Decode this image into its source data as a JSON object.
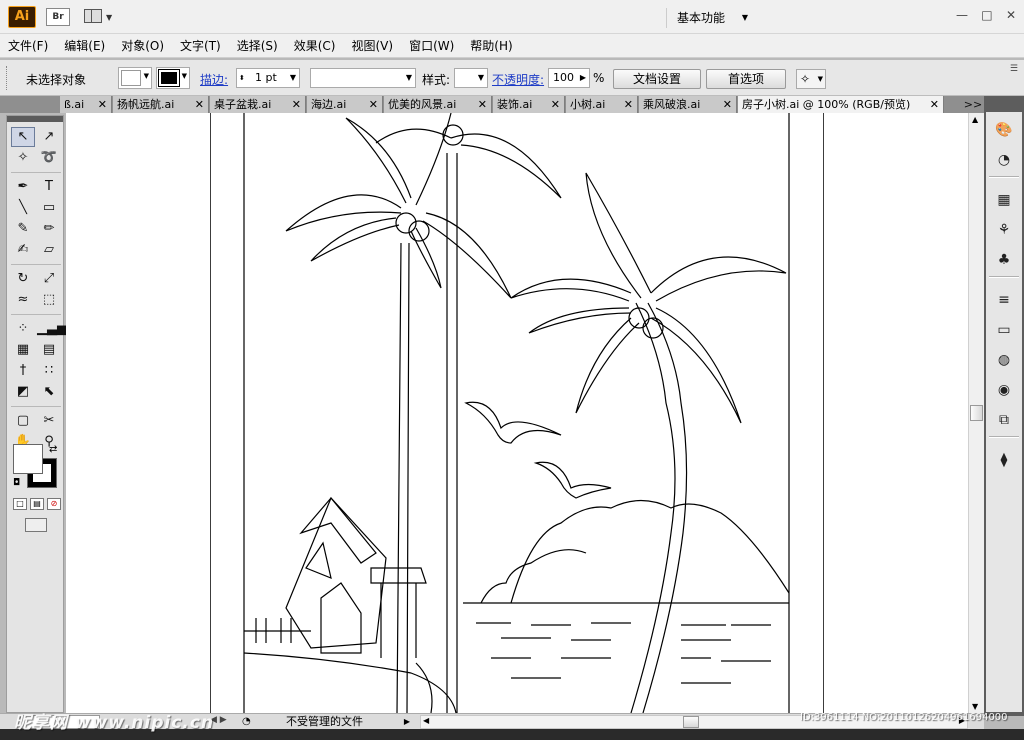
{
  "app": {
    "logo": "Ai",
    "bridge_label": "Br",
    "workspace": "基本功能"
  },
  "window_controls": {
    "minimize": "—",
    "restore": "□",
    "close": "✕"
  },
  "menu": [
    "文件(F)",
    "编辑(E)",
    "对象(O)",
    "文字(T)",
    "选择(S)",
    "效果(C)",
    "视图(V)",
    "窗口(W)",
    "帮助(H)"
  ],
  "control": {
    "selection_status": "未选择对象",
    "stroke_label": "描边:",
    "stroke_weight": "1 pt",
    "style_label": "样式:",
    "opacity_label": "不透明度:",
    "opacity_value": "100",
    "opacity_unit": "%",
    "doc_setup_button": "文档设置",
    "preferences_button": "首选项"
  },
  "tabs": [
    {
      "label": "ß.ai",
      "active": false
    },
    {
      "label": "扬帆远航.ai",
      "active": false
    },
    {
      "label": "桌子盆栽.ai",
      "active": false
    },
    {
      "label": "海边.ai",
      "active": false
    },
    {
      "label": "优美的风景.ai",
      "active": false
    },
    {
      "label": "装饰.ai",
      "active": false
    },
    {
      "label": "小树.ai",
      "active": false
    },
    {
      "label": "乘风破浪.ai",
      "active": false
    },
    {
      "label": "房子小树.ai @ 100% (RGB/预览)",
      "active": true
    }
  ],
  "tab_overflow": ">>",
  "tab_close": "✕",
  "tools": [
    [
      "selection-tool",
      "↖"
    ],
    [
      "direct-selection-tool",
      "↗"
    ],
    [
      "magic-wand-tool",
      "✧"
    ],
    [
      "lasso-tool",
      "➰"
    ],
    [
      "pen-tool",
      "✒"
    ],
    [
      "type-tool",
      "T"
    ],
    [
      "line-tool",
      "╲"
    ],
    [
      "rectangle-tool",
      "▭"
    ],
    [
      "paintbrush-tool",
      "✎"
    ],
    [
      "pencil-tool",
      "✏"
    ],
    [
      "blob-brush-tool",
      "✍"
    ],
    [
      "eraser-tool",
      "▱"
    ],
    [
      "rotate-tool",
      "↻"
    ],
    [
      "scale-tool",
      "⤢"
    ],
    [
      "warp-tool",
      "≈"
    ],
    [
      "free-transform-tool",
      "⬚"
    ],
    [
      "symbol-sprayer-tool",
      "⁘"
    ],
    [
      "column-graph-tool",
      "▁▃▅"
    ],
    [
      "mesh-tool",
      "▦"
    ],
    [
      "gradient-tool",
      "▤"
    ],
    [
      "eyedropper-tool",
      "†"
    ],
    [
      "blend-tool",
      "∷"
    ],
    [
      "live-paint-bucket-tool",
      "◩"
    ],
    [
      "live-paint-selection-tool",
      "⬉"
    ],
    [
      "artboard-tool",
      "▢"
    ],
    [
      "slice-tool",
      "✂"
    ],
    [
      "hand-tool",
      "✋"
    ],
    [
      "zoom-tool",
      "⚲"
    ]
  ],
  "tools_extra": {
    "swap_icon": "⇄",
    "default_colors_icon": "◘",
    "color_mode": "□",
    "gradient_mode": "▤",
    "none_mode": "⊘"
  },
  "dock_icons": [
    [
      "brushes-panel-icon",
      "🎨"
    ],
    [
      "appearance-panel-icon",
      "◔"
    ],
    [
      "swatches-panel-icon",
      "▦"
    ],
    [
      "symbols-panel-icon",
      "⚘"
    ],
    [
      "graphic-styles-panel-icon",
      "♣"
    ],
    [
      "stroke-panel-icon",
      "≡"
    ],
    [
      "gradient-panel-icon",
      "▭"
    ],
    [
      "transparency-panel-icon",
      "◍"
    ],
    [
      "color-panel-icon",
      "◉"
    ],
    [
      "transform-panel-icon",
      "⧉"
    ],
    [
      "layers-panel-icon",
      "⧫"
    ]
  ],
  "status": {
    "zoom_value": "",
    "nav_arrows": "◀ ▶",
    "text": "不受管理的文件",
    "scroll_left": "◀",
    "scroll_right": "▶",
    "scroll_up": "▲",
    "scroll_down": "▼"
  },
  "watermark": {
    "logo": "昵享网 www.nipic.cn",
    "id": "ID:3961114 NO:20110126204961694000"
  }
}
